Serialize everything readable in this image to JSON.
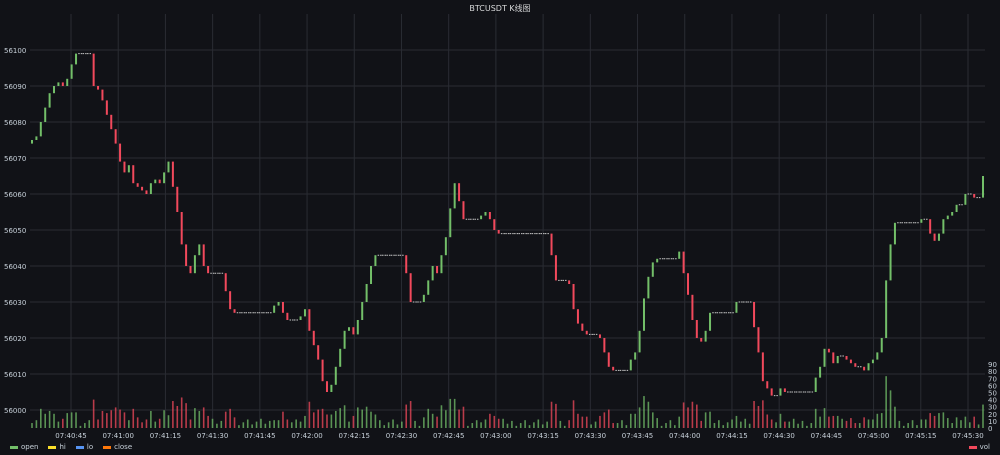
{
  "chart_data": {
    "type": "candlestick",
    "title": "BTCUSDT K线图",
    "colors": {
      "up": "#73bf69",
      "down": "#f2495c",
      "doji": "#c8c8c8",
      "grid": "#2a2c33",
      "text": "#c7d0d9"
    },
    "price_axis": {
      "min": 55995,
      "max": 56110,
      "ticks": [
        56000,
        56010,
        56020,
        56030,
        56040,
        56050,
        56060,
        56070,
        56080,
        56090,
        56100
      ]
    },
    "volume_axis": {
      "min": 0,
      "max": 100,
      "ticks": [
        0,
        10,
        20,
        30,
        40,
        50,
        60,
        70,
        80,
        90
      ]
    },
    "time_ticks": [
      "07:40:45",
      "07:41:00",
      "07:41:15",
      "07:41:30",
      "07:41:45",
      "07:42:00",
      "07:42:15",
      "07:42:30",
      "07:42:45",
      "07:43:00",
      "07:43:15",
      "07:43:30",
      "07:43:45",
      "07:44:00",
      "07:44:15",
      "07:44:30",
      "07:44:45",
      "07:45:00",
      "07:45:15",
      "07:45:30"
    ],
    "close": [
      56075,
      56076,
      56080,
      56084,
      56088,
      56090,
      56091,
      56090,
      56092,
      56096,
      56099,
      56099,
      56099,
      56099,
      56090,
      56089,
      56086,
      56082,
      56078,
      56074,
      56069,
      56066,
      56068,
      56063,
      56062,
      56061,
      56060,
      56063,
      56064,
      56063,
      56066,
      56069,
      56062,
      56055,
      56046,
      56040,
      56038,
      56043,
      56046,
      56040,
      56038,
      56038,
      56038,
      56038,
      56033,
      56028,
      56027,
      56027,
      56027,
      56027,
      56027,
      56027,
      56027,
      56027,
      56027,
      56029,
      56030,
      56027,
      56025,
      56025,
      56025,
      56026,
      56028,
      56022,
      56018,
      56014,
      56008,
      56005,
      56007,
      56012,
      56017,
      56022,
      56023,
      56021,
      56025,
      56030,
      56035,
      56040,
      56043,
      56043,
      56043,
      56043,
      56043,
      56043,
      56043,
      56038,
      56030,
      56030,
      56030,
      56032,
      56036,
      56040,
      56038,
      56043,
      56048,
      56056,
      56063,
      56058,
      56053,
      56053,
      56053,
      56053,
      56054,
      56055,
      56053,
      56050,
      56049,
      56049,
      56049,
      56049,
      56049,
      56049,
      56049,
      56049,
      56049,
      56049,
      56049,
      56049,
      56043,
      56036,
      56036,
      56036,
      56035,
      56028,
      56024,
      56022,
      56021,
      56021,
      56021,
      56020,
      56016,
      56012,
      56011,
      56011,
      56011,
      56011,
      56014,
      56016,
      56022,
      56031,
      56037,
      56041,
      56042,
      56042,
      56042,
      56042,
      56042,
      56044,
      56038,
      56032,
      56025,
      56020,
      56019,
      56022,
      56027,
      56027,
      56027,
      56027,
      56027,
      56027,
      56030,
      56030,
      56030,
      56030,
      56023,
      56016,
      56008,
      56006,
      56004,
      56004,
      56006,
      56005,
      56005,
      56005,
      56005,
      56005,
      56005,
      56005,
      56009,
      56012,
      56017,
      56016,
      56013,
      56015,
      56015,
      56014,
      56013,
      56012,
      56012,
      56011,
      56013,
      56014,
      56016,
      56020,
      56036,
      56046,
      56052,
      56052,
      56052,
      56052,
      56052,
      56052,
      56053,
      56053,
      56049,
      56047,
      56049,
      56053,
      56054,
      56055,
      56057,
      56057,
      56060,
      56060,
      56059,
      56059,
      56065
    ]
  }
}
